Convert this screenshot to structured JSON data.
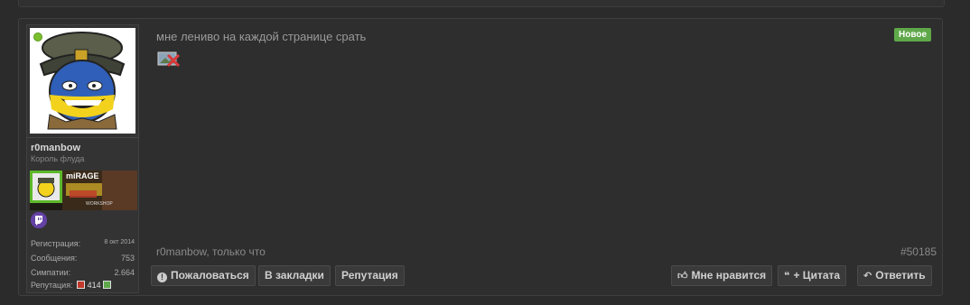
{
  "user": {
    "name": "r0manbow",
    "title": "Король флуда",
    "stats": [
      {
        "label": "Регистрация:",
        "value": "8 окт 2014"
      },
      {
        "label": "Сообщения:",
        "value": "753"
      },
      {
        "label": "Симпатии:",
        "value": "2.664"
      },
      {
        "label": "Репутация:",
        "value": "414"
      }
    ],
    "banner": {
      "brand": "miRAGE",
      "workshop": "WORKSHOP"
    },
    "twitch_icon": "twitch-icon"
  },
  "post": {
    "text": "мне лениво на каждой странице срать",
    "badge": "Новое",
    "meta": "r0manbow, только что",
    "number": "#50185"
  },
  "actions": {
    "report": "Пожаловаться",
    "bookmark": "В закладки",
    "reputation": "Репутация",
    "like": "Мне нравится",
    "quote": "+ Цитата",
    "reply": "Ответить"
  },
  "colors": {
    "badge": "#5fa84a",
    "online": "#7cbf2e",
    "twitch": "#6441a5"
  }
}
